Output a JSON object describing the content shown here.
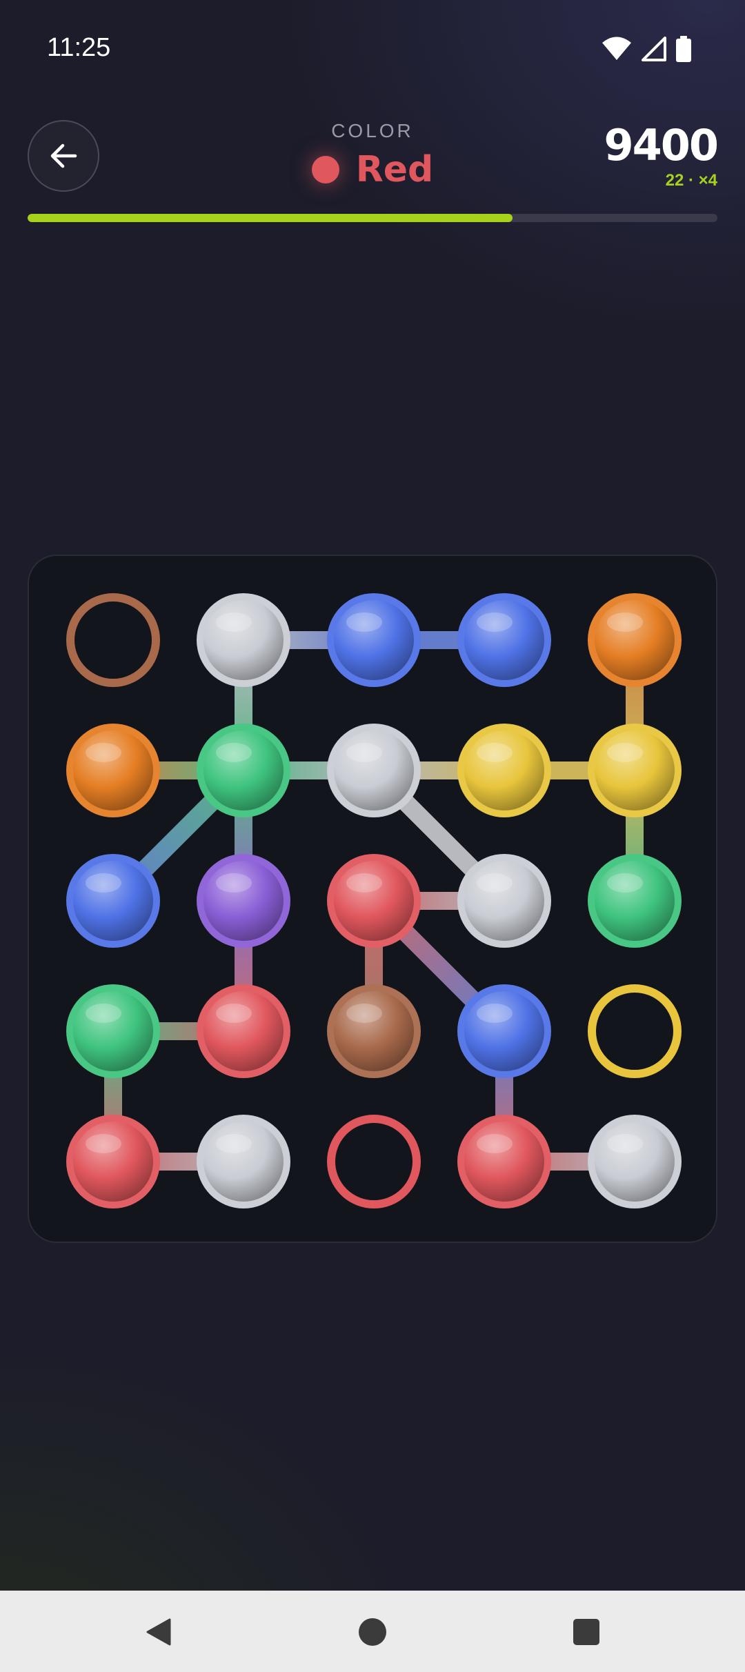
{
  "status": {
    "time": "11:25"
  },
  "header": {
    "color_label": "COLOR",
    "target_color_name": "Red",
    "target_color_hex": "#e0575d",
    "score": "9400",
    "score_sub": "22 · ×4",
    "progress": 0.703
  },
  "colors": {
    "red": "#e0575d",
    "blue": "#4f72e6",
    "silver": "#c9ccd3",
    "orange": "#e57e24",
    "yellow": "#e8c53c",
    "green": "#3fc47e",
    "purple": "#8a5ed6",
    "brown": "#a96a4c",
    "accent": "#a6d21c"
  },
  "grid": {
    "rows": 5,
    "cols": 5,
    "cells": [
      [
        {
          "color": "brown",
          "filled": false
        },
        {
          "color": "silver",
          "filled": true
        },
        {
          "color": "blue",
          "filled": true
        },
        {
          "color": "blue",
          "filled": true
        },
        {
          "color": "orange",
          "filled": true
        }
      ],
      [
        {
          "color": "orange",
          "filled": true
        },
        {
          "color": "green",
          "filled": true
        },
        {
          "color": "silver",
          "filled": true
        },
        {
          "color": "yellow",
          "filled": true
        },
        {
          "color": "yellow",
          "filled": true
        }
      ],
      [
        {
          "color": "blue",
          "filled": true
        },
        {
          "color": "purple",
          "filled": true
        },
        {
          "color": "red",
          "filled": true
        },
        {
          "color": "silver",
          "filled": true
        },
        {
          "color": "green",
          "filled": true
        }
      ],
      [
        {
          "color": "green",
          "filled": true
        },
        {
          "color": "red",
          "filled": true
        },
        {
          "color": "brown",
          "filled": true
        },
        {
          "color": "blue",
          "filled": true
        },
        {
          "color": "yellow",
          "filled": false
        }
      ],
      [
        {
          "color": "red",
          "filled": true
        },
        {
          "color": "silver",
          "filled": true
        },
        {
          "color": "red",
          "filled": false
        },
        {
          "color": "red",
          "filled": true
        },
        {
          "color": "silver",
          "filled": true
        }
      ]
    ],
    "connections": [
      [
        [
          0,
          1
        ],
        [
          0,
          2
        ]
      ],
      [
        [
          0,
          2
        ],
        [
          0,
          3
        ]
      ],
      [
        [
          0,
          1
        ],
        [
          1,
          1
        ]
      ],
      [
        [
          0,
          4
        ],
        [
          1,
          4
        ]
      ],
      [
        [
          1,
          0
        ],
        [
          1,
          1
        ]
      ],
      [
        [
          1,
          1
        ],
        [
          1,
          2
        ]
      ],
      [
        [
          1,
          2
        ],
        [
          1,
          3
        ]
      ],
      [
        [
          1,
          3
        ],
        [
          1,
          4
        ]
      ],
      [
        [
          1,
          1
        ],
        [
          2,
          0
        ]
      ],
      [
        [
          1,
          1
        ],
        [
          2,
          1
        ]
      ],
      [
        [
          1,
          2
        ],
        [
          2,
          3
        ]
      ],
      [
        [
          1,
          4
        ],
        [
          2,
          4
        ]
      ],
      [
        [
          2,
          1
        ],
        [
          3,
          1
        ]
      ],
      [
        [
          2,
          2
        ],
        [
          2,
          3
        ]
      ],
      [
        [
          2,
          2
        ],
        [
          3,
          2
        ]
      ],
      [
        [
          2,
          2
        ],
        [
          3,
          3
        ]
      ],
      [
        [
          3,
          0
        ],
        [
          3,
          1
        ]
      ],
      [
        [
          3,
          0
        ],
        [
          4,
          0
        ]
      ],
      [
        [
          3,
          3
        ],
        [
          4,
          3
        ]
      ],
      [
        [
          4,
          0
        ],
        [
          4,
          1
        ]
      ],
      [
        [
          4,
          3
        ],
        [
          4,
          4
        ]
      ]
    ]
  }
}
